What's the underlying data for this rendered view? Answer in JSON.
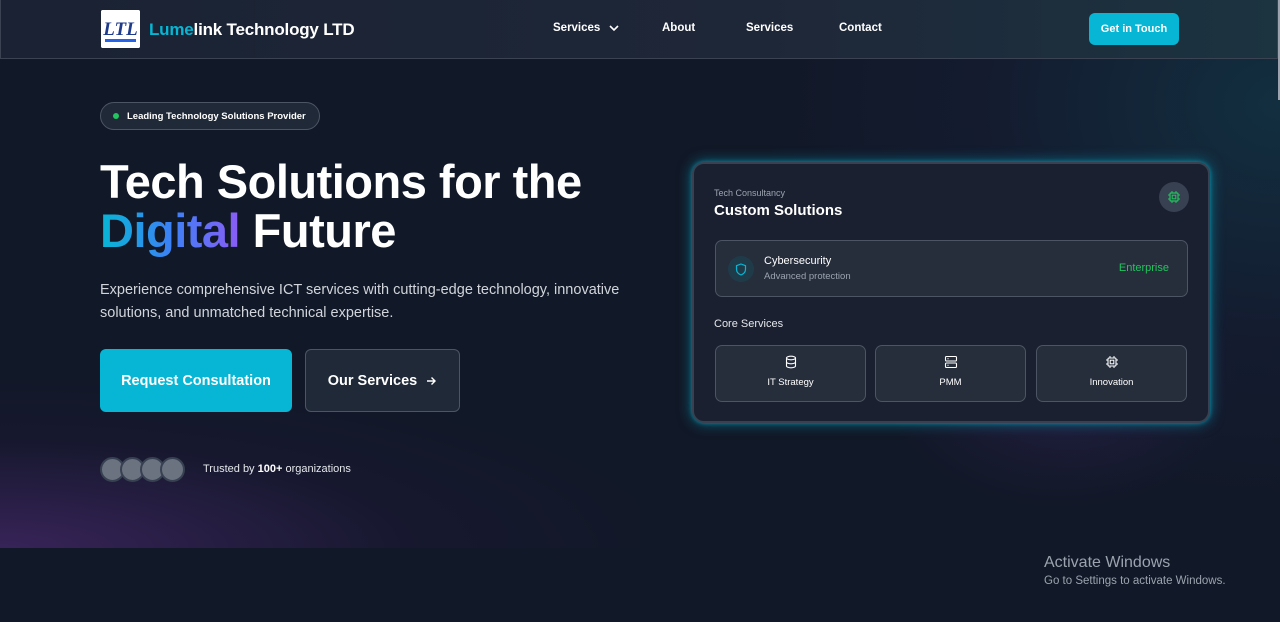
{
  "brand": {
    "name_accent": "Lume",
    "name_rest": "link Technology LTD",
    "logo_text": "LTL"
  },
  "nav": {
    "items": [
      {
        "label": "Services",
        "dropdown": true
      },
      {
        "label": "About"
      },
      {
        "label": "Services"
      },
      {
        "label": "Contact"
      }
    ],
    "cta": "Get in Touch"
  },
  "hero": {
    "badge": "Leading Technology Solutions Provider",
    "title_line1": "Tech Solutions for the",
    "title_highlight": "Digital",
    "title_line2_rest": " Future",
    "lead": "Experience comprehensive ICT services with cutting-edge technology, innovative solutions, and unmatched technical expertise.",
    "primary_button": "Request Consultation",
    "secondary_button": "Our Services",
    "trusted_prefix": "Trusted by ",
    "trusted_count": "100+",
    "trusted_suffix": " organizations"
  },
  "card": {
    "kicker": "Tech Consultancy",
    "title": "Custom Solutions",
    "feature": {
      "title": "Cybersecurity",
      "subtitle": "Advanced protection",
      "tag": "Enterprise"
    },
    "core_label": "Core Services",
    "services": [
      {
        "label": "IT Strategy",
        "icon": "database-icon"
      },
      {
        "label": "PMM",
        "icon": "server-icon"
      },
      {
        "label": "Innovation",
        "icon": "cpu-icon"
      }
    ]
  },
  "watermark": {
    "title": "Activate Windows",
    "subtitle": "Go to Settings to activate Windows."
  },
  "colors": {
    "accent": "#06b6d4",
    "background": "#111827",
    "success": "#22c55e"
  }
}
